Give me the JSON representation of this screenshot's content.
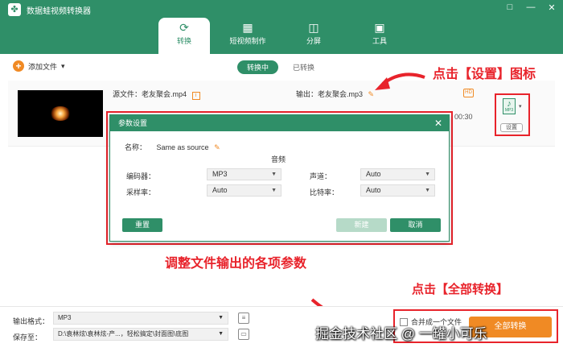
{
  "app": {
    "title": "数据蛙视频转换器"
  },
  "window_controls": [
    "□",
    "—",
    "✕"
  ],
  "tabs": [
    {
      "label": "转换",
      "icon": "convert-icon"
    },
    {
      "label": "短视频制作",
      "icon": "film-icon"
    },
    {
      "label": "分屏",
      "icon": "split-screen-icon"
    },
    {
      "label": "工具",
      "icon": "toolbox-icon"
    }
  ],
  "toolbar": {
    "add_file": "添加文件",
    "converting": "转换中",
    "converted": "已转换"
  },
  "file": {
    "source_label": "源文件：老友聚会.mp4",
    "output_label": "输出：老友聚会.mp3",
    "badge": "HD",
    "time": "00:30",
    "format_icon_text": "MP3",
    "settings_button": "设置"
  },
  "dialog": {
    "title": "参数设置",
    "name_label": "名称：",
    "name_value": "Same as source",
    "section": "音频",
    "encoder_label": "编码器：",
    "encoder_value": "MP3",
    "channel_label": "声道：",
    "channel_value": "Auto",
    "sample_rate_label": "采样率：",
    "sample_rate_value": "Auto",
    "bitrate_label": "比特率：",
    "bitrate_value": "Auto",
    "reset": "重置",
    "new": "新建",
    "cancel": "取消"
  },
  "annotations": {
    "settings_hint": "点击【设置】图标",
    "params_hint": "调整文件输出的各项参数",
    "convert_hint": "点击【全部转换】"
  },
  "bottom": {
    "format_label": "输出格式：",
    "format_value": "MP3",
    "save_label": "保存至：",
    "save_value": "D:\\袁林炫\\袁林炫-产...，轻松搞定\\封面图\\底图",
    "merge_label": "合并成一个文件",
    "convert_all": "全部转换"
  },
  "watermark": "掘金技术社区 @ 一罐小可乐",
  "colors": {
    "brand": "#2f8f68",
    "accent": "#f08a24",
    "annotation": "#e8232b"
  }
}
